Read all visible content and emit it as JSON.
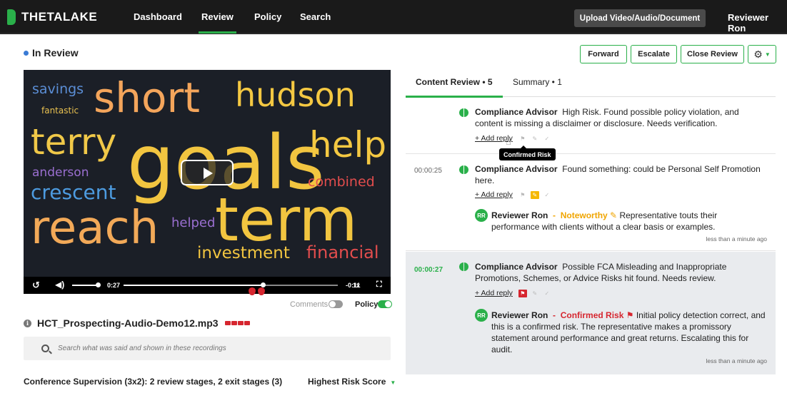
{
  "nav": {
    "brand_prefix": "THETA",
    "brand_suffix": "LAKE",
    "links": [
      "Dashboard",
      "Review",
      "Policy",
      "Search"
    ],
    "active": "Review",
    "upload_label": "Upload Video/Audio/Document",
    "user": "Reviewer Ron"
  },
  "status": {
    "label": "In Review",
    "dot_color": "#3a7bd5"
  },
  "actions": {
    "forward": "Forward",
    "escalate": "Escalate",
    "close": "Close Review"
  },
  "video": {
    "word_cloud": [
      {
        "text": "savings",
        "color": "#5b8ed6"
      },
      {
        "text": "fantastic",
        "color": "#e8c050"
      },
      {
        "text": "short",
        "color": "#f4a55b"
      },
      {
        "text": "hudson",
        "color": "#f4c842"
      },
      {
        "text": "terry",
        "color": "#f0c848"
      },
      {
        "text": "goals",
        "color": "#f2c540"
      },
      {
        "text": "help",
        "color": "#f4c842"
      },
      {
        "text": "anderson",
        "color": "#9a6fd0"
      },
      {
        "text": "crescent",
        "color": "#4d9be0"
      },
      {
        "text": "combined",
        "color": "#e24d4d"
      },
      {
        "text": "reach",
        "color": "#f2a958"
      },
      {
        "text": "helped",
        "color": "#9a6fd0"
      },
      {
        "text": "term",
        "color": "#f2c540"
      },
      {
        "text": "investment",
        "color": "#f2c540"
      },
      {
        "text": "financial",
        "color": "#e24d4d"
      }
    ],
    "elapsed": "0:27",
    "remaining": "-0:11",
    "speed": "1x",
    "progress_fraction": 0.65
  },
  "toggles": {
    "comments_label": "Comments",
    "comments_on": false,
    "policy_label": "Policy",
    "policy_on": true
  },
  "file": {
    "name": "HCT_Prospecting-Audio-Demo12.mp3"
  },
  "search": {
    "placeholder": "Search what was said and shown in these recordings"
  },
  "workflow": {
    "supervision": "Conference Supervision (3x2): 2 review stages, 2 exit stages (3)",
    "sort_label": "Highest Risk Score"
  },
  "tabs": {
    "content_review": "Content Review • 5",
    "summary": "Summary • 1"
  },
  "comments": [
    {
      "timestamp": "",
      "author": "Compliance Advisor",
      "text": "High Risk. Found possible policy violation, and content is missing a disclaimer or disclosure. Needs verification.",
      "add_reply": "+ Add reply",
      "tooltip": "Confirmed Risk"
    },
    {
      "timestamp": "00:00:25",
      "author": "Compliance Advisor",
      "text": "Found something: could be Personal Self Promotion here.",
      "add_reply": "+ Add reply",
      "reply": {
        "initials": "RR",
        "author": "Reviewer Ron",
        "tag": "Noteworthy",
        "text": "Representative touts their performance with clients without a clear basis or examples.",
        "time": "less than a minute ago"
      }
    },
    {
      "timestamp": "00:00:27",
      "author": "Compliance Advisor",
      "text": "Possible FCA Misleading and Inappropriate Promotions, Schemes, or Advice Risks hit found. Needs review.",
      "add_reply": "+ Add reply",
      "reply": {
        "initials": "RR",
        "author": "Reviewer Ron",
        "tag": "Confirmed Risk",
        "text": "Initial policy detection correct, and this is a confirmed risk. The representative makes a promissory statement around performance and great returns. Escalating this for audit.",
        "time": "less than a minute ago"
      }
    }
  ],
  "colors": {
    "brand_green": "#2ab04a",
    "risk_red": "#d6262f",
    "noteworthy_yellow": "#f0a500",
    "nav_bg": "#1a1a1a"
  }
}
